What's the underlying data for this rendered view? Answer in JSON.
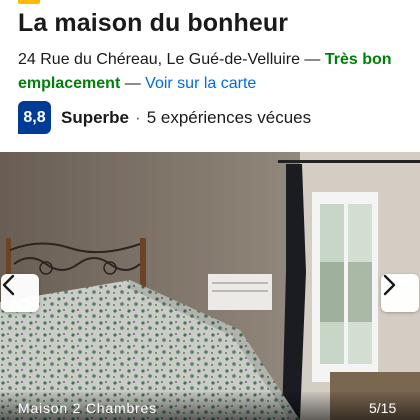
{
  "header": {
    "title": "La maison du bonheur",
    "address": "24 Rue du Chéreau, Le Gué-de-Velluire",
    "separator": " — ",
    "location_badge": "Très bon emplacement",
    "map_link": "Voir sur la carte"
  },
  "review": {
    "score": "8,8",
    "label": "Superbe",
    "separator": "·",
    "count_text": "5 expériences vécues"
  },
  "gallery": {
    "caption": "Maison 2 Chambres",
    "counter": "5/15",
    "current": 5,
    "total": 15
  },
  "colors": {
    "brand_blue": "#003b95",
    "link_blue": "#006ce4",
    "location_green": "#008009",
    "star_yellow": "#febb02"
  },
  "icons": {
    "prev": "chevron-left-icon",
    "next": "chevron-right-icon"
  }
}
